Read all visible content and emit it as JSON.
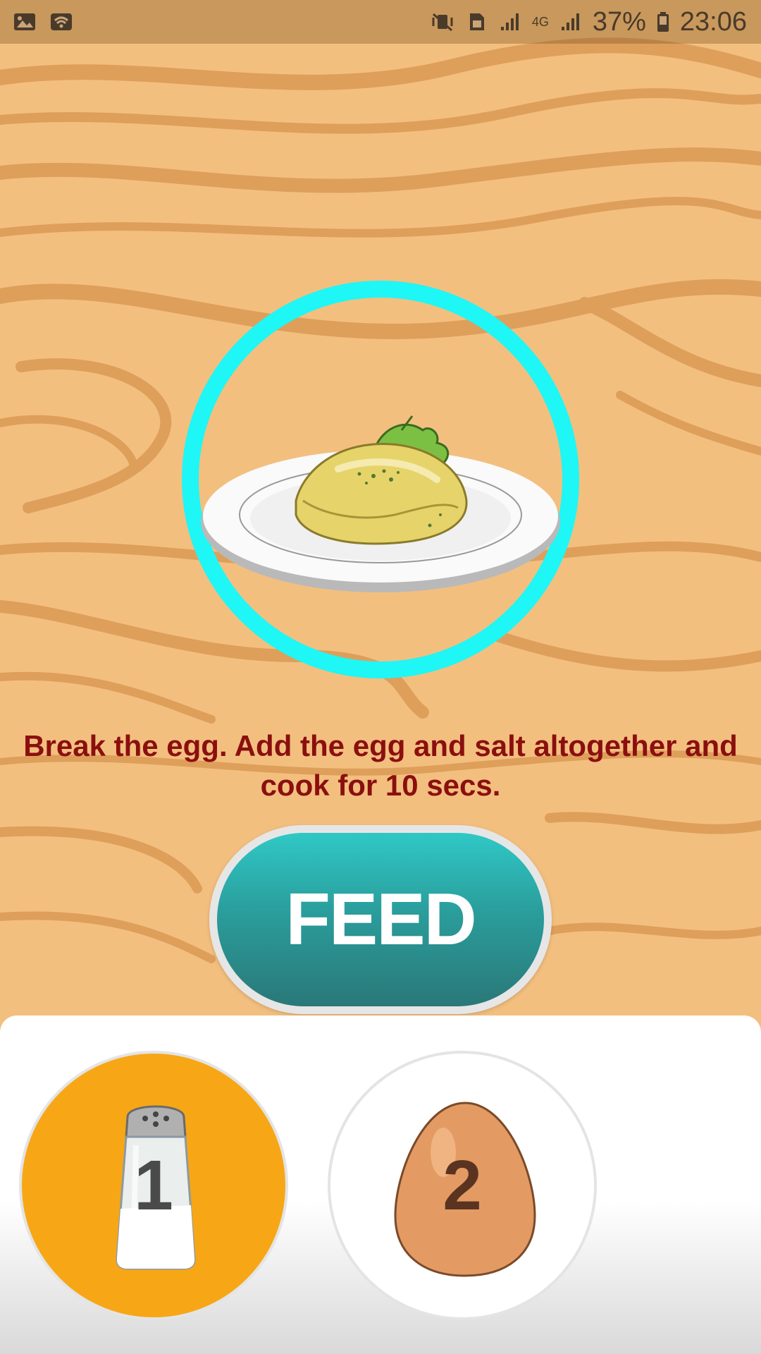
{
  "status_bar": {
    "battery_percent": "37%",
    "time": "23:06",
    "network": "4G",
    "icons": [
      "gallery-icon",
      "wifi-icon",
      "mute-vibrate-icon",
      "sim-icon",
      "signal-icon",
      "signal-4g-icon",
      "battery-icon"
    ]
  },
  "game": {
    "dish": "omelette-on-plate",
    "ring_color": "#1FF6F6",
    "instruction": "Break the egg. Add the egg and salt altogether and cook for 10 secs.",
    "feed_button": "FEED"
  },
  "ingredients": [
    {
      "name": "salt-shaker",
      "number": "1",
      "selected": true,
      "bg_color": "#F7A715"
    },
    {
      "name": "egg",
      "number": "2",
      "selected": false,
      "bg_color": "#FFFFFF"
    }
  ]
}
